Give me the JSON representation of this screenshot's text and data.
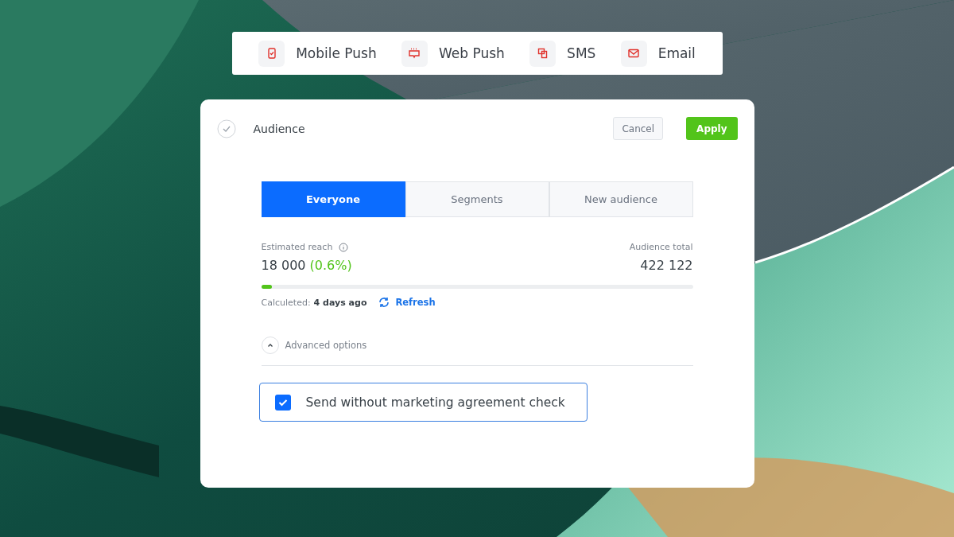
{
  "channels": [
    {
      "kind": "mobile",
      "label": "Mobile Push"
    },
    {
      "kind": "web",
      "label": "Web Push"
    },
    {
      "kind": "sms",
      "label": "SMS"
    },
    {
      "kind": "email",
      "label": "Email"
    }
  ],
  "panel": {
    "title": "Audience",
    "done": true,
    "buttons": {
      "cancel": "Cancel",
      "apply": "Apply"
    }
  },
  "tabs": [
    {
      "label": "Everyone",
      "selected": true
    },
    {
      "label": "Segments",
      "selected": false
    },
    {
      "label": "New audience",
      "selected": false
    }
  ],
  "reach": {
    "label": "Estimated reach",
    "value": "18 000",
    "share": "(0.6%)",
    "total_label": "Audience total",
    "total": "422 122",
    "level": 0.025,
    "calculated_label": "Calculeted:",
    "calculated": "4 days ago",
    "refresh": "Refresh"
  },
  "advanced": {
    "label": "Advanced options",
    "expanded": true
  },
  "option": {
    "label": "Send without marketing agreement check",
    "checked": true
  }
}
